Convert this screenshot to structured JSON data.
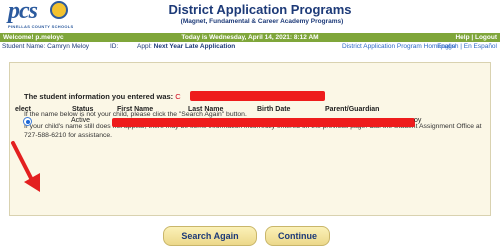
{
  "header": {
    "logo_text": "pcs",
    "logo_subtext": "PINELLAS COUNTY SCHOOLS",
    "title": "District Application Programs",
    "subtitle": "(Magnet, Fundamental & Career Academy Programs)"
  },
  "topbar": {
    "welcome": "Welcome! p.meloyc",
    "today": "Today is Wednesday, April 14, 2021: 8:12 AM",
    "help_logout": "Help | Logout"
  },
  "student_bar": {
    "name": "Student Name: Camryn Meloy",
    "id_label": "ID:",
    "appl_label": "Appl:",
    "appl_value": "Next Year Late Application",
    "homepage_link": "District Application Program Homepage",
    "language_links": "English | En Español"
  },
  "panel": {
    "info_label": "The student information you entered was:",
    "info_value": "C",
    "hint1": "If the name below is not your child, please click the \"Search Again\" button.",
    "hint2": "If your child's name still does not appear, there may be some information incorrectly entered on the previous page. Call the Student Assignment Office at 727-588-6210 for assistance."
  },
  "table": {
    "headers": [
      "elect",
      "Status",
      "First Name",
      "Last Name",
      "Birth Date",
      "Parent/Guardian"
    ],
    "row": {
      "status": "Active",
      "guardian_tail": "oy"
    }
  },
  "buttons": {
    "search_again": "Search Again",
    "continue": "Continue"
  },
  "colors": {
    "brand_blue": "#1d3a78",
    "header_green": "#7fa63a",
    "panel_bg": "#fbf7e6",
    "redaction_red": "#ee1c1c",
    "button_gold": "#ecd88a"
  },
  "icons": {
    "arrow": "red-arrow-icon",
    "radio": "radio-selected-icon"
  }
}
